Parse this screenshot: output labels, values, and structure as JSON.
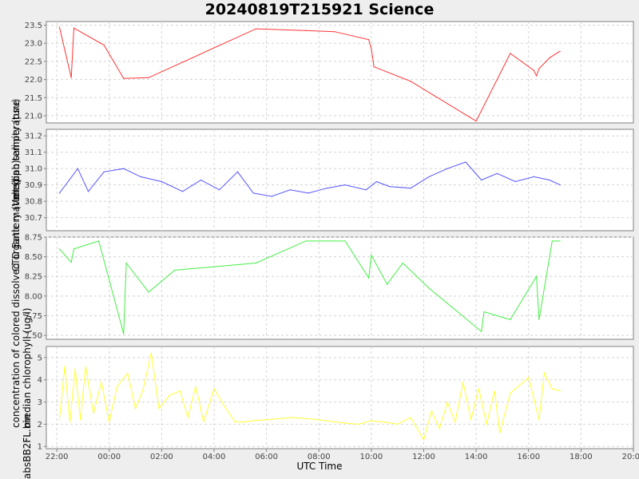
{
  "title": "20240819T215921 Science",
  "xlabel": "UTC Time",
  "ylabels": [
    "median temperature",
    "median salinity (psu)",
    "CTD Battery (Volts)",
    "concentration of colored dissolved organic matter (ppb)",
    "median chlorophyll (ug/l)",
    "absBB2FL.bin"
  ],
  "x_ticks": [
    "22:00",
    "00:00",
    "02:00",
    "04:00",
    "06:00",
    "08:00",
    "10:00",
    "12:00",
    "14:00",
    "16:00",
    "18:00",
    "20:00"
  ],
  "colors": {
    "temperature": "#ff3333",
    "salinity": "#5555ff",
    "cdom": "#44ee44",
    "chlorophyll": "#ffff33"
  },
  "chart_data": [
    {
      "type": "line",
      "series_name": "temperature",
      "ylim": [
        20.8,
        23.6
      ],
      "yticks": [
        21.0,
        21.5,
        22.0,
        22.5,
        23.0,
        23.5
      ],
      "x": [
        22.1,
        22.55,
        22.65,
        23.8,
        24.55,
        25.5,
        29.6,
        31.5,
        32.6,
        33.9,
        34.0,
        34.1,
        35.5,
        38.0,
        39.3,
        40.2,
        40.3,
        40.4,
        40.8,
        41.2
      ],
      "y": [
        23.45,
        22.05,
        23.42,
        22.95,
        22.03,
        22.05,
        23.4,
        23.35,
        23.32,
        23.1,
        22.85,
        22.35,
        21.95,
        20.85,
        22.72,
        22.25,
        22.1,
        22.3,
        22.6,
        22.78
      ]
    },
    {
      "type": "line",
      "series_name": "salinity",
      "ylim": [
        30.62,
        31.24
      ],
      "yticks": [
        30.7,
        30.8,
        30.9,
        31.0,
        31.1,
        31.2
      ],
      "x": [
        22.1,
        22.8,
        23.2,
        23.8,
        24.55,
        25.2,
        26.0,
        26.8,
        27.5,
        28.2,
        28.9,
        29.5,
        30.2,
        30.9,
        31.6,
        32.3,
        33.0,
        33.8,
        34.2,
        34.7,
        35.5,
        36.2,
        36.9,
        37.6,
        38.2,
        38.8,
        39.5,
        40.2,
        40.8,
        41.2
      ],
      "y": [
        30.85,
        31.0,
        30.86,
        30.98,
        31.0,
        30.95,
        30.92,
        30.86,
        30.93,
        30.87,
        30.98,
        30.85,
        30.83,
        30.87,
        30.85,
        30.88,
        30.9,
        30.87,
        30.92,
        30.89,
        30.88,
        30.95,
        31.0,
        31.04,
        30.93,
        30.97,
        30.92,
        30.95,
        30.93,
        30.9
      ]
    },
    {
      "type": "line",
      "series_name": "cdom",
      "ylim": [
        7.45,
        8.75
      ],
      "yticks": [
        7.5,
        7.75,
        8.0,
        8.25,
        8.5,
        8.75
      ],
      "x": [
        22.1,
        22.55,
        22.65,
        23.6,
        24.55,
        24.65,
        25.5,
        26.5,
        29.6,
        31.5,
        33.0,
        33.9,
        34.0,
        34.6,
        35.2,
        36.2,
        38.2,
        38.3,
        39.3,
        40.3,
        40.4,
        40.9,
        41.2
      ],
      "y": [
        8.6,
        8.43,
        8.6,
        8.7,
        7.52,
        8.42,
        8.05,
        8.33,
        8.42,
        8.7,
        8.7,
        8.23,
        8.52,
        8.15,
        8.42,
        8.1,
        7.55,
        7.8,
        7.7,
        8.25,
        7.7,
        8.7,
        8.7
      ]
    },
    {
      "type": "line",
      "series_name": "chlorophyll",
      "ylim": [
        0.9,
        5.5
      ],
      "yticks": [
        1,
        2,
        3,
        4,
        5
      ],
      "x": [
        22.1,
        22.3,
        22.5,
        22.7,
        22.9,
        23.1,
        23.4,
        23.7,
        24.0,
        24.3,
        24.7,
        25.0,
        25.3,
        25.6,
        25.9,
        26.3,
        26.7,
        27.0,
        27.3,
        27.6,
        28.0,
        28.4,
        28.8,
        29.1,
        29.4,
        30.0,
        31.0,
        32.0,
        33.0,
        33.5,
        34.0,
        34.5,
        35.0,
        35.5,
        36.0,
        36.3,
        36.6,
        36.9,
        37.2,
        37.5,
        37.8,
        38.1,
        38.4,
        38.7,
        38.9,
        39.3,
        39.6,
        40.0,
        40.4,
        40.6,
        40.9,
        41.2
      ],
      "y": [
        2.2,
        4.6,
        2.1,
        4.5,
        2.2,
        4.6,
        2.5,
        3.9,
        2.1,
        3.7,
        4.3,
        2.7,
        3.6,
        5.2,
        2.7,
        3.3,
        3.5,
        2.3,
        3.7,
        2.1,
        3.6,
        2.8,
        2.1,
        2.1,
        2.15,
        2.2,
        2.3,
        2.2,
        2.05,
        2.0,
        2.15,
        2.1,
        2.0,
        2.3,
        1.3,
        2.6,
        1.8,
        3.0,
        2.1,
        3.9,
        2.2,
        3.6,
        2.0,
        3.5,
        1.6,
        3.4,
        3.7,
        4.1,
        2.2,
        4.3,
        3.6,
        3.5
      ]
    }
  ]
}
